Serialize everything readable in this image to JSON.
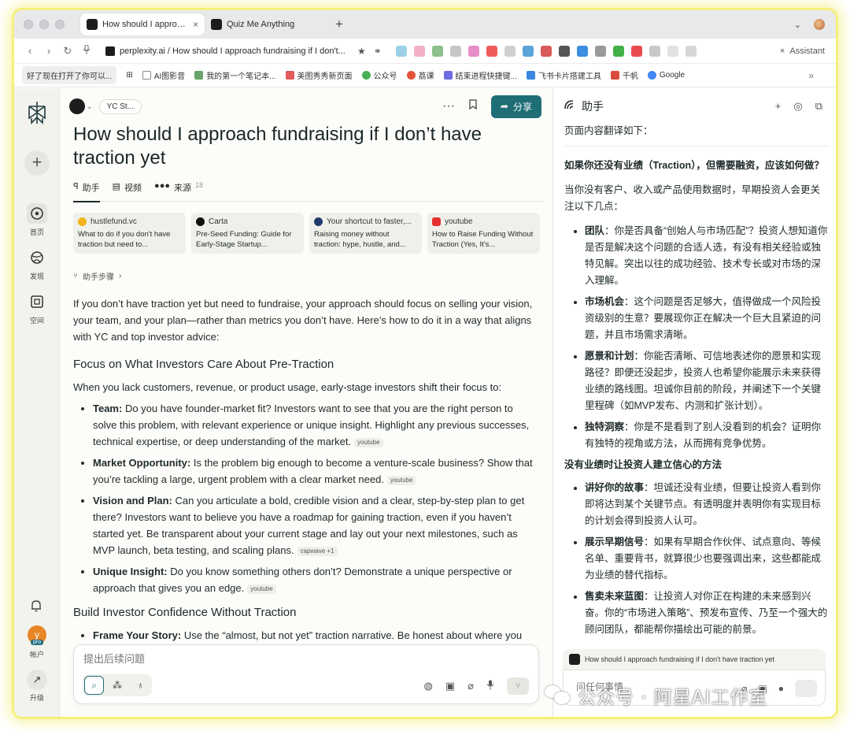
{
  "browser": {
    "tabs": [
      {
        "label": "How should I approach fund"
      },
      {
        "label": "Quiz Me Anything"
      }
    ],
    "url": "perplexity.ai / How should I approach fundraising if I don't...",
    "assistant_label": "Assistant",
    "bookmarks": [
      {
        "label": "好了现在打开了你可以..."
      },
      {
        "label": "AI图影音"
      },
      {
        "label": "我的第一个笔记本..."
      },
      {
        "label": "美图秀秀新页面"
      },
      {
        "label": "公众号"
      },
      {
        "label": "荔课"
      },
      {
        "label": "结束进程快捷键..."
      },
      {
        "label": "飞书卡片搭建工具"
      },
      {
        "label": "千帆"
      },
      {
        "label": "Google"
      }
    ]
  },
  "rail": {
    "items": [
      {
        "label": "首页"
      },
      {
        "label": "发现"
      },
      {
        "label": "空间"
      }
    ],
    "avatar_letter": "y",
    "pro_badge": "pro",
    "account_label": "帐户",
    "upgrade_label": "升级"
  },
  "main": {
    "space_chip": "YC St...",
    "share_label": "分享",
    "title": "How should I approach fundraising if I don’t have traction yet",
    "tabs": [
      {
        "label": "助手"
      },
      {
        "label": "视频"
      },
      {
        "label": "来源",
        "count": "18"
      }
    ],
    "sources": [
      {
        "site": "hustlefund.vc",
        "title": "What to do if you don't have traction but need to..."
      },
      {
        "site": "Carta",
        "title": "Pre-Seed Funding: Guide for Early-Stage Startup..."
      },
      {
        "site": "Your shortcut to faster,...",
        "title": "Raising money without traction: hype, hustle, and..."
      },
      {
        "site": "youtube",
        "title": "How to Raise Funding Without Traction (Yes, It's..."
      }
    ],
    "steps_label": "助手步骤",
    "intro": "If you don’t have traction yet but need to fundraise, your approach should focus on selling your vision, your team, and your plan—rather than metrics you don’t have. Here’s how to do it in a way that aligns with YC and top investor advice:",
    "h1": "Focus on What Investors Care About Pre-Traction",
    "h1_lead": "When you lack customers, revenue, or product usage, early-stage investors shift their focus to:",
    "bullets": [
      {
        "bold": "Team:",
        "text": " Do you have founder-market fit? Investors want to see that you are the right person to solve this problem, with relevant experience or unique insight. Highlight any previous successes, technical expertise, or deep understanding of the market.",
        "cite": "youtube"
      },
      {
        "bold": "Market Opportunity:",
        "text": " Is the problem big enough to become a venture-scale business? Show that you’re tackling a large, urgent problem with a clear market need.",
        "cite": "youtube"
      },
      {
        "bold": "Vision and Plan:",
        "text": " Can you articulate a bold, credible vision and a clear, step-by-step plan to get there? Investors want to believe you have a roadmap for gaining traction, even if you haven’t started yet. Be transparent about your current stage and lay out your next milestones, such as MVP launch, beta testing, and scaling plans.",
        "cite": "capwave +1"
      },
      {
        "bold": "Unique Insight:",
        "text": " Do you know something others don’t? Demonstrate a unique perspective or approach that gives you an edge.",
        "cite": "youtube"
      }
    ],
    "h2": "Build Investor Confidence Without Traction",
    "bullets2": [
      {
        "bold": "Frame Your Story:",
        "text": " Use the “almost, but not yet” traction narrative. Be honest about where you"
      }
    ],
    "composer_placeholder": "提出后续问题"
  },
  "assistant": {
    "title": "助手",
    "intro": "页面内容翻译如下：",
    "q_title": "如果你还没有业绩（Traction），但需要融资，应该如何做？",
    "lead": "当你没有客户、收入或产品使用数据时，早期投资人会更关注以下几点：",
    "points": [
      {
        "bold": "团队",
        "text": "：你是否具备“创始人与市场匹配”？投资人想知道你是否是解决这个问题的合适人选，有没有相关经验或独特见解。突出以往的成功经验、技术专长或对市场的深入理解。"
      },
      {
        "bold": "市场机会",
        "text": "：这个问题是否足够大，值得做成一个风险投资级别的生意？要展现你正在解决一个巨大且紧迫的问题，并且市场需求清晰。"
      },
      {
        "bold": "愿景和计划",
        "text": "：你能否清晰、可信地表述你的愿景和实现路径？即便还没起步，投资人也希望你能展示未来获得业绩的路线图。坦诚你目前的阶段，并阐述下一个关键里程碑（如MVP发布、内测和扩张计划）。"
      },
      {
        "bold": "独特洞察",
        "text": "：你是不是看到了别人没看到的机会？证明你有独特的视角或方法，从而拥有竞争优势。"
      }
    ],
    "h2": "没有业绩时让投资人建立信心的方法",
    "points2": [
      {
        "bold": "讲好你的故事",
        "text": "：坦诚还没有业绩，但要让投资人看到你即将达到某个关键节点。有透明度并表明你有实现目标的计划会得到投资人认可。"
      },
      {
        "bold": "展示早期信号",
        "text": "：如果有早期合作伙伴、试点意向、等候名单、重要背书，就算很少也要强调出来，这些都能成为业绩的替代指标。"
      },
      {
        "bold": "售卖未来蓝图",
        "text": "：让投资人对你正在构建的未来感到兴奋。你的“市场进入策略”、预发布宣传、乃至一个强大的顾问团队，都能帮你描绘出可能的前景。"
      }
    ],
    "context_chip": "How should I approach fundraising if I don't have traction yet",
    "input_placeholder": "问任何事情..."
  },
  "watermark": "公众号 · 阿星AI工作室",
  "colors": {
    "accent": "#1f6e76",
    "rail_bg": "#f3f3ee",
    "main_bg": "#fcfcf9",
    "highlight": "#f4f07a"
  }
}
